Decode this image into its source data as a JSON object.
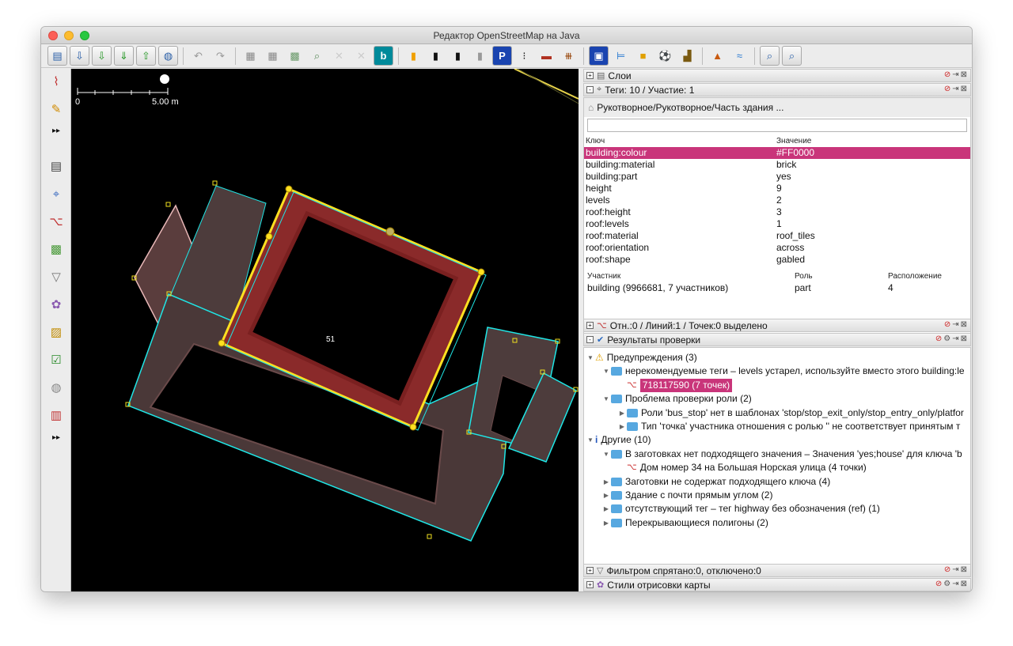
{
  "window": {
    "title": "Редактор OpenStreetMap на Java"
  },
  "toolbar": {
    "icons": [
      "open-file-icon",
      "save-icon",
      "download-icon",
      "download-area-icon",
      "upload-icon",
      "upload-changes-icon",
      "undo-icon",
      "redo-icon",
      "imagery-icon",
      "imagery-icon",
      "wms-icon",
      "zoom-icon",
      "imagery-icon",
      "imagery-icon",
      "bing-icon",
      "road-icon",
      "road-icon",
      "road-icon",
      "road-icon",
      "parking-icon",
      "traffic-light-icon",
      "wall-icon",
      "railway-icon",
      "info-icon",
      "bed-icon",
      "shop-icon",
      "football-icon",
      "industrial-icon",
      "peak-icon",
      "waterway-icon",
      "search-icon",
      "search-icon"
    ],
    "bing_label": "b",
    "parking_label": "P"
  },
  "sidebar": {
    "icons": [
      "draw-node-icon",
      "pencil-icon",
      "more-icon",
      "layers-icon",
      "tags-icon",
      "relations-icon",
      "images-icon",
      "filter-icon",
      "style-icon",
      "validator-icon",
      "checklist-icon",
      "globe-icon",
      "barcode-icon",
      "more-icon"
    ],
    "more_label": "▸▸"
  },
  "map": {
    "scale_start": "0",
    "scale_end": "5.00 m",
    "way_label": "51"
  },
  "panels": {
    "layers": {
      "title": "Слои"
    },
    "tags": {
      "title": "Теги: 10 / Участие: 1",
      "preset": "Рукотворное/Рукотворное/Часть здания ...",
      "search_value": "",
      "col_key": "Ключ",
      "col_value": "Значение",
      "rows": [
        {
          "key": "building:colour",
          "value": "#FF0000",
          "selected": true
        },
        {
          "key": "building:material",
          "value": "brick"
        },
        {
          "key": "building:part",
          "value": "yes"
        },
        {
          "key": "height",
          "value": "9"
        },
        {
          "key": "levels",
          "value": "2"
        },
        {
          "key": "roof:height",
          "value": "3"
        },
        {
          "key": "roof:levels",
          "value": "1"
        },
        {
          "key": "roof:material",
          "value": "roof_tiles"
        },
        {
          "key": "roof:orientation",
          "value": "across"
        },
        {
          "key": "roof:shape",
          "value": "gabled"
        }
      ],
      "member_col_member": "Участник",
      "member_col_role": "Роль",
      "member_col_pos": "Расположение",
      "members": [
        {
          "member": "building (9966681, 7 участников)",
          "role": "part",
          "pos": "4"
        }
      ]
    },
    "selection": {
      "title": "Отн.:0 / Линий:1 / Точек:0 выделено"
    },
    "validation": {
      "title": "Результаты проверки",
      "items": [
        {
          "level": 0,
          "arrow": "▼",
          "icon": "warning-icon",
          "text": "Предупреждения (3)"
        },
        {
          "level": 1,
          "arrow": "▼",
          "icon": "folder-icon",
          "text": "нерекомендуемые теги – levels устарел, используйте вместо этого building:le"
        },
        {
          "level": 2,
          "arrow": "",
          "icon": "way-icon",
          "text": "718117590 (7 точек)",
          "highlight": true
        },
        {
          "level": 1,
          "arrow": "▼",
          "icon": "folder-icon",
          "text": "Проблема проверки роли (2)"
        },
        {
          "level": 2,
          "arrow": "▶",
          "icon": "folder-icon",
          "text": "Роли 'bus_stop' нет в шаблонах 'stop/stop_exit_only/stop_entry_only/platfor"
        },
        {
          "level": 2,
          "arrow": "▶",
          "icon": "folder-icon",
          "text": "Тип 'точка' участника отношения с ролью '' не соответствует принятым т"
        },
        {
          "level": 0,
          "arrow": "▼",
          "icon": "info-icon",
          "text": "Другие (10)"
        },
        {
          "level": 1,
          "arrow": "▼",
          "icon": "folder-icon",
          "text": "В заготовках нет подходящего значения – Значения 'yes;house' для ключа 'b"
        },
        {
          "level": 2,
          "arrow": "",
          "icon": "way-icon",
          "text": "Дом номер 34 на Большая Норская улица (4 точки)"
        },
        {
          "level": 1,
          "arrow": "▶",
          "icon": "folder-icon",
          "text": "Заготовки не содержат подходящего ключа (4)"
        },
        {
          "level": 1,
          "arrow": "▶",
          "icon": "folder-icon",
          "text": "Здание с почти прямым углом (2)"
        },
        {
          "level": 1,
          "arrow": "▶",
          "icon": "folder-icon",
          "text": "отсутствующий тег – тег highway без обозначения (ref) (1)"
        },
        {
          "level": 1,
          "arrow": "▶",
          "icon": "folder-icon",
          "text": "Перекрывающиеся полигоны (2)"
        }
      ]
    },
    "filter": {
      "title": "Фильтром спрятано:0, отключено:0"
    },
    "styles": {
      "title": "Стили отрисовки карты"
    }
  }
}
